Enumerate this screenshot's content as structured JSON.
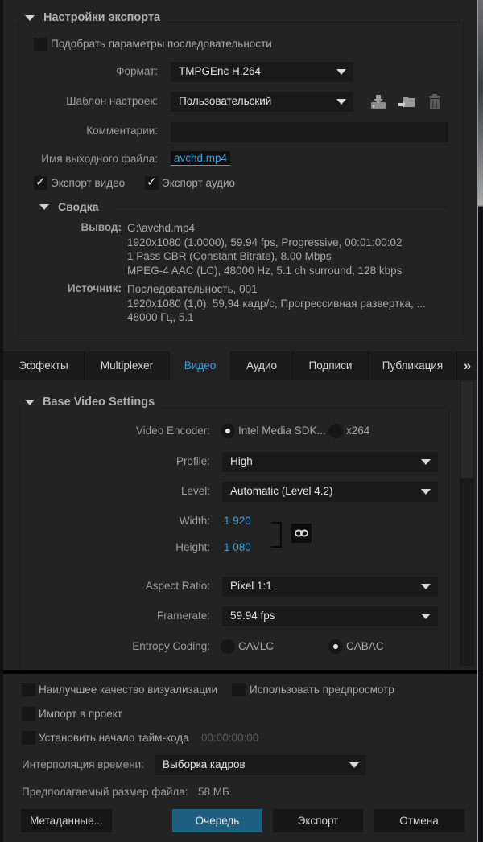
{
  "export_settings": {
    "title": "Настройки экспорта",
    "match_sequence_label": "Подобрать параметры последовательности",
    "match_sequence_checked": false,
    "format_label": "Формат:",
    "format_value": "TMPGEnc H.264",
    "preset_label": "Шаблон настроек:",
    "preset_value": "Пользовательский",
    "preset_icons": [
      "save-preset-icon",
      "import-preset-icon",
      "delete-preset-icon"
    ],
    "comments_label": "Комментарии:",
    "comments_value": "",
    "output_name_label": "Имя выходного файла:",
    "output_name_value": "avchd.mp4",
    "export_video_label": "Экспорт видео",
    "export_video_checked": true,
    "export_audio_label": "Экспорт аудио",
    "export_audio_checked": true
  },
  "summary": {
    "title": "Сводка",
    "output_label": "Вывод:",
    "output_lines": [
      "G:\\avchd.mp4",
      "1920x1080 (1.0000), 59.94 fps, Progressive, 00:01:00:02",
      "1 Pass CBR (Constant Bitrate), 8.00 Mbps",
      "MPEG-4 AAC (LC), 48000 Hz, 5.1 ch surround, 128 kbps"
    ],
    "source_label": "Источник:",
    "source_lines": [
      "Последовательность, 001",
      "1920x1080 (1,0), 59,94 кадр/с, Прогрессивная развертка, ...",
      "48000 Гц, 5.1"
    ]
  },
  "tabs": [
    {
      "label": "Эффекты",
      "active": false
    },
    {
      "label": "Multiplexer",
      "active": false
    },
    {
      "label": "Видео",
      "active": true
    },
    {
      "label": "Аудио",
      "active": false
    },
    {
      "label": "Подписи",
      "active": false
    },
    {
      "label": "Публикация",
      "active": false
    }
  ],
  "tabs_overflow": "»",
  "video": {
    "section_title": "Base Video Settings",
    "encoder_label": "Video Encoder:",
    "encoder_options": [
      {
        "label": "Intel Media SDK...",
        "selected": true
      },
      {
        "label": "x264",
        "selected": false
      }
    ],
    "profile_label": "Profile:",
    "profile_value": "High",
    "level_label": "Level:",
    "level_value": "Automatic (Level 4.2)",
    "width_label": "Width:",
    "width_value": "1 920",
    "height_label": "Height:",
    "height_value": "1 080",
    "aspect_label": "Aspect Ratio:",
    "aspect_value": "Pixel 1:1",
    "framerate_label": "Framerate:",
    "framerate_value": "59.94 fps",
    "entropy_label": "Entropy Coding:",
    "entropy_options": [
      {
        "label": "CAVLC",
        "selected": false
      },
      {
        "label": "CABAC",
        "selected": true
      }
    ]
  },
  "bottom": {
    "max_render_quality_label": "Наилучшее качество визуализации",
    "use_previews_label": "Использовать предпросмотр",
    "import_project_label": "Импорт в проект",
    "set_timecode_label": "Установить начало тайм-кода",
    "timecode_value": "00:00:00:00",
    "time_interp_label": "Интерполяция времени:",
    "time_interp_value": "Выборка кадров",
    "est_size_label": "Предполагаемый размер файла:",
    "est_size_value": "58 МБ",
    "metadata_button": "Метаданные...",
    "queue_button": "Очередь",
    "export_button": "Экспорт",
    "cancel_button": "Отмена"
  },
  "colors": {
    "accent": "#3d9fdf",
    "primary_button": "#1e5f82",
    "background": "#232323"
  }
}
